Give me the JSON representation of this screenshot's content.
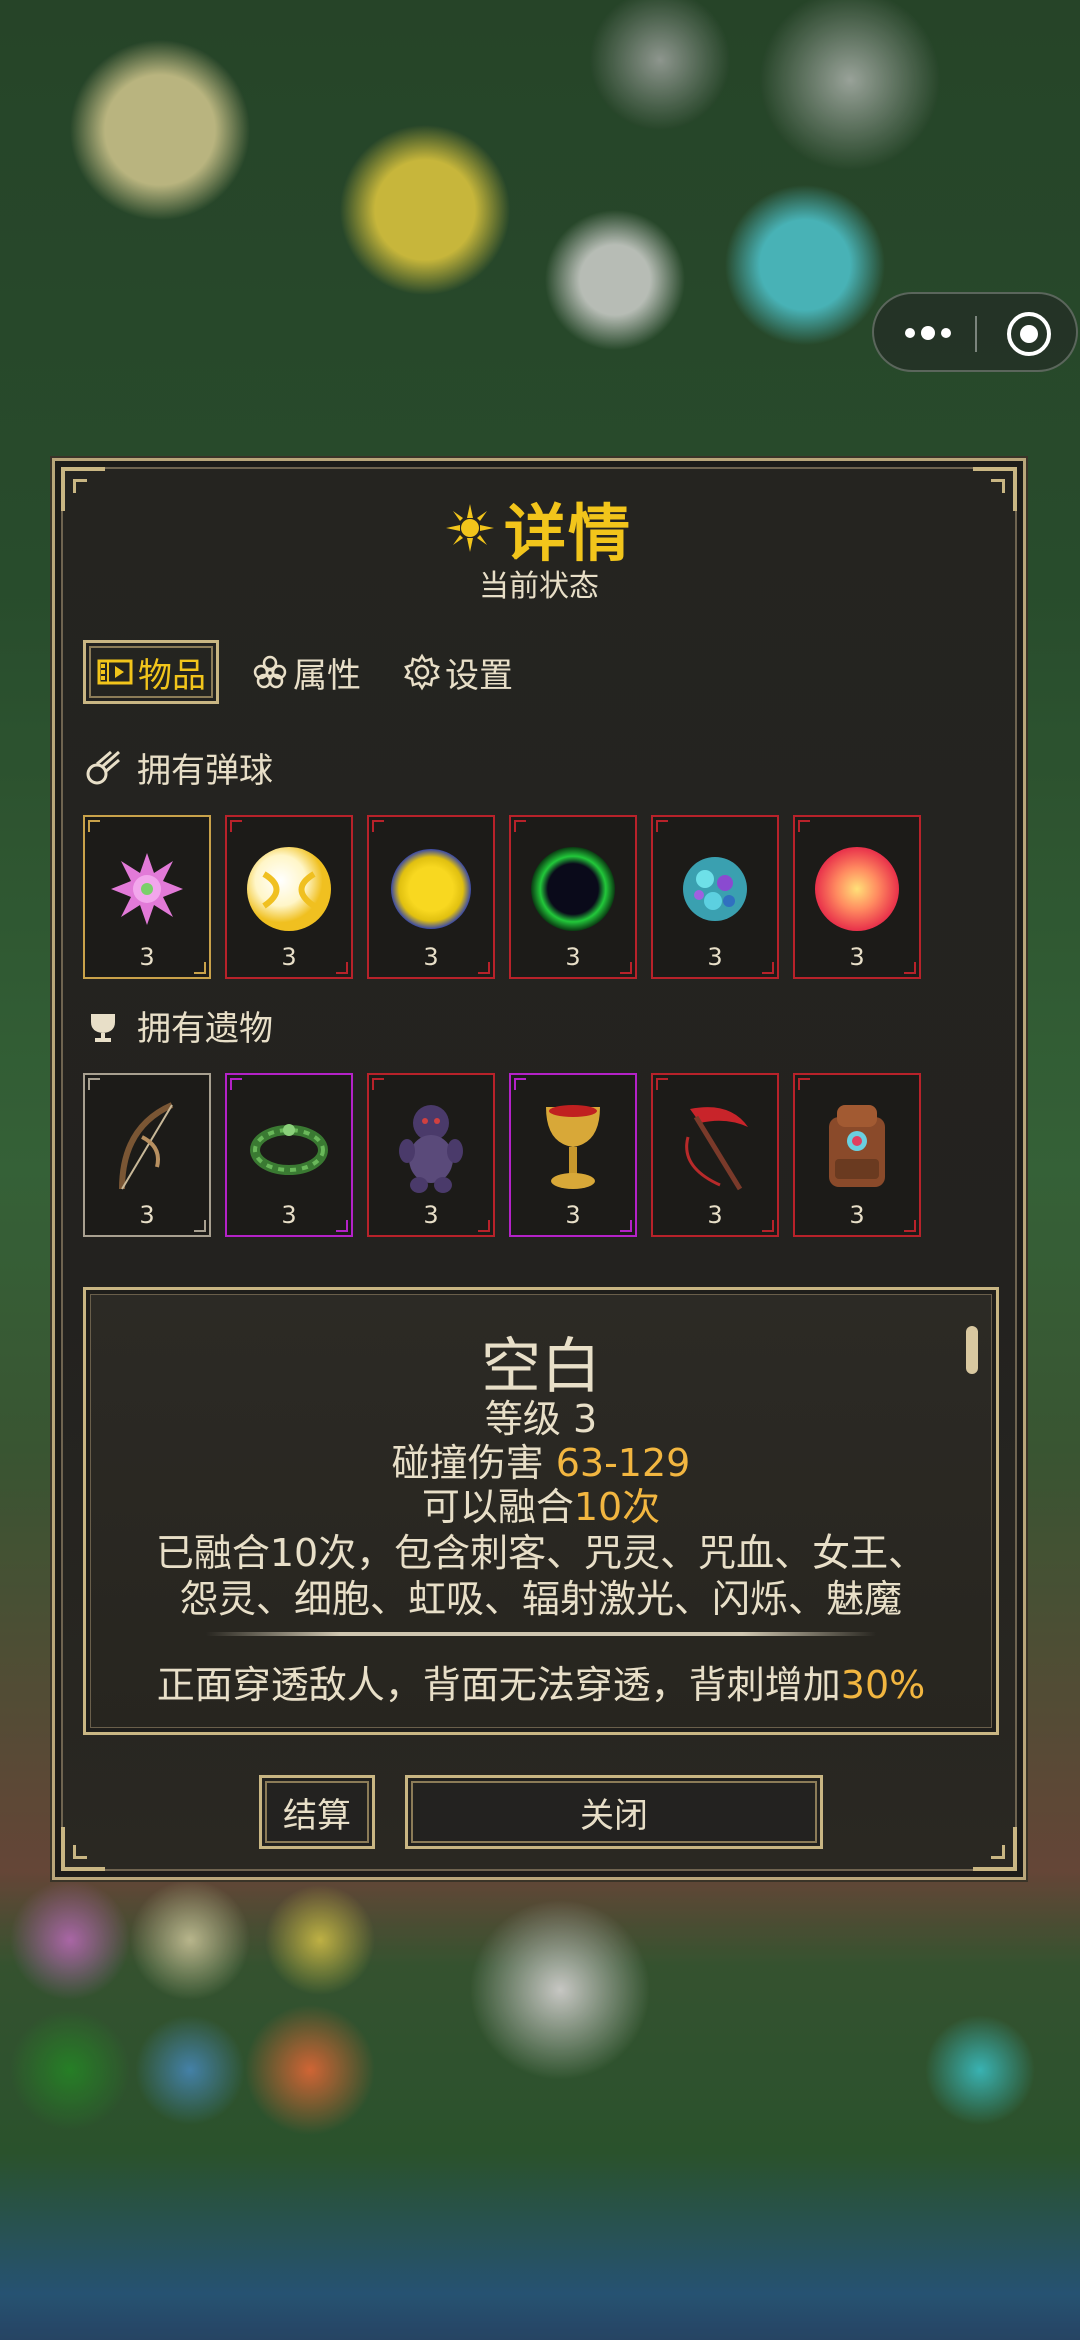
{
  "panel": {
    "title": "详情",
    "subtitle": "当前状态",
    "tabs": [
      {
        "label": "物品",
        "icon": "film-icon",
        "active": true
      },
      {
        "label": "属性",
        "icon": "flower-icon",
        "active": false
      },
      {
        "label": "设置",
        "icon": "gear-icon",
        "active": false
      }
    ]
  },
  "balls": {
    "heading": "拥有弹球",
    "items": [
      {
        "name": "spiky-pink-ball-icon",
        "count": "3",
        "frame": "gold"
      },
      {
        "name": "yellow-white-ball-icon",
        "count": "3",
        "frame": "red"
      },
      {
        "name": "yellow-core-ball-icon",
        "count": "3",
        "frame": "red"
      },
      {
        "name": "black-hole-ball-icon",
        "count": "3",
        "frame": "red"
      },
      {
        "name": "cyan-crystal-ball-icon",
        "count": "3",
        "frame": "red"
      },
      {
        "name": "red-orange-ball-icon",
        "count": "3",
        "frame": "red"
      }
    ]
  },
  "relics": {
    "heading": "拥有遗物",
    "items": [
      {
        "name": "bow-relic-icon",
        "count": "3",
        "frame": "silver"
      },
      {
        "name": "thorn-wreath-relic-icon",
        "count": "3",
        "frame": "purple"
      },
      {
        "name": "voodoo-doll-relic-icon",
        "count": "3",
        "frame": "red"
      },
      {
        "name": "golden-chalice-relic-icon",
        "count": "3",
        "frame": "purple"
      },
      {
        "name": "red-scythe-relic-icon",
        "count": "3",
        "frame": "red"
      },
      {
        "name": "backpack-relic-icon",
        "count": "3",
        "frame": "red"
      }
    ]
  },
  "detail": {
    "name": "空白",
    "level": "等级 3",
    "damage_label": "碰撞伤害 ",
    "damage_value": "63-129",
    "fuse_label": "可以融合",
    "fuse_value": "10次",
    "fused_line1": "已融合10次，包含刺客、咒灵、咒血、女王、",
    "fused_line2": "怨灵、细胞、虹吸、辐射激光、闪烁、魅魔",
    "effect_text": "正面穿透敌人，背面无法穿透，背刺增加",
    "effect_value": "30%"
  },
  "buttons": {
    "settle": "结算",
    "close": "关闭"
  },
  "colors": {
    "accent_gold": "#f2c51b",
    "frame_red": "#b8222a",
    "frame_purple": "#b422c8",
    "text": "#e8dfc8"
  }
}
